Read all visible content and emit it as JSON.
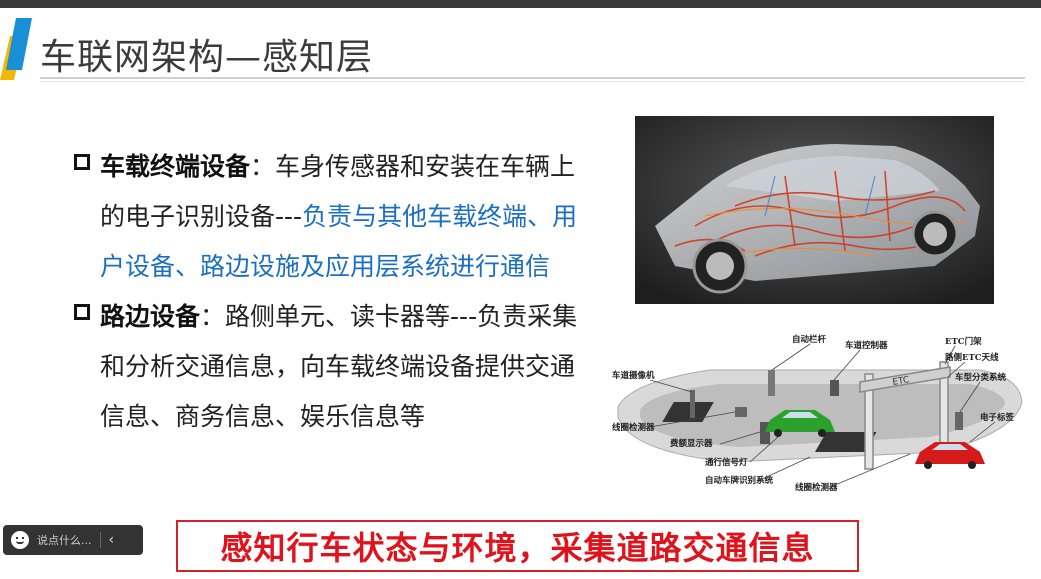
{
  "header": {
    "title": "车联网架构—感知层"
  },
  "bullets": [
    {
      "heading": "车载终端设备",
      "sep": "：",
      "text": "车身传感器和安装在车辆上的电子识别设备---",
      "highlight": "负责与其他车载终端、用户设备、路边设施及应用层系统进行通信"
    },
    {
      "heading": "路边设备",
      "sep": "：",
      "text": "路侧单元、读卡器等---负责采集和分析交通信息，向车载终端设备提供交通信息、商务信息、娱乐信息等",
      "highlight": ""
    }
  ],
  "diagram_labels": {
    "l1": "自动栏杆",
    "l2": "车道控制器",
    "l3": "ETC门架",
    "l4": "路侧ETC天线",
    "l5": "车道摄像机",
    "l6": "车型分类系统",
    "l7": "线圈检测器",
    "l8": "费额显示器",
    "l9": "电子标签",
    "l10": "通行信号灯",
    "l11": "自动车牌识别系统",
    "l12": "线圈检测器",
    "gantry": "ETC"
  },
  "comment": {
    "placeholder": "说点什么...",
    "collapse": "‹"
  },
  "banner": "感知行车状态与环境，采集道路交通信息",
  "colors": {
    "accent_blue": "#1b6fc2",
    "banner_red": "#e0121b",
    "accent_bar": "#1a8fd6"
  }
}
